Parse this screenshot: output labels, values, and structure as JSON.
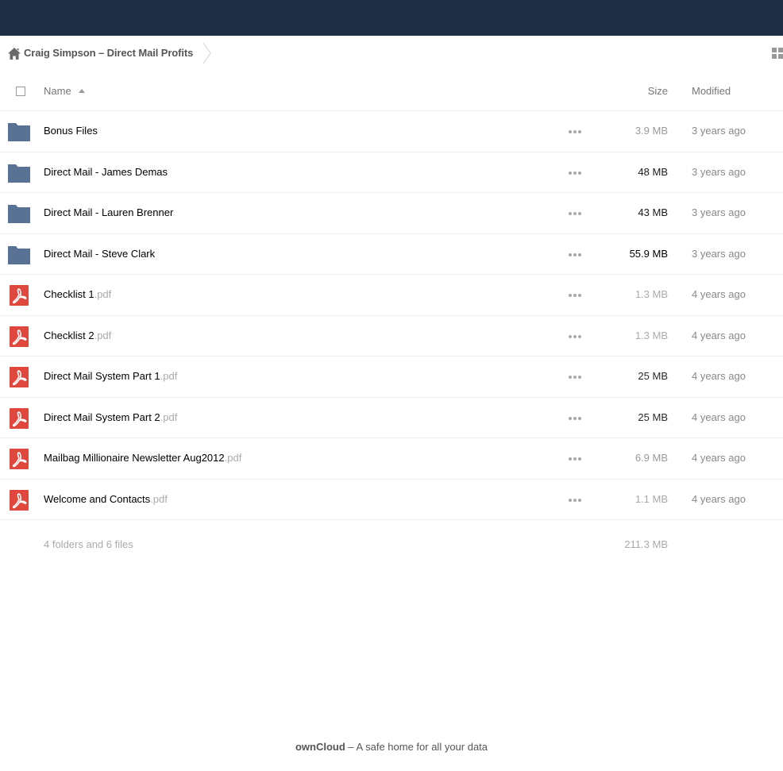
{
  "breadcrumb": {
    "home_icon": "home-icon",
    "title": "Craig Simpson – Direct Mail Profits"
  },
  "header": {
    "name_label": "Name",
    "size_label": "Size",
    "modified_label": "Modified"
  },
  "files": [
    {
      "name": "Bonus Files",
      "ext": "",
      "type": "folder",
      "size": "3.9 MB",
      "size_color": "#9a9a9a",
      "modified": "3 years ago"
    },
    {
      "name": "Direct Mail - James Demas",
      "ext": "",
      "type": "folder",
      "size": "48 MB",
      "size_color": "#1a1a1a",
      "modified": "3 years ago"
    },
    {
      "name": "Direct Mail - Lauren Brenner",
      "ext": "",
      "type": "folder",
      "size": "43 MB",
      "size_color": "#1a1a1a",
      "modified": "3 years ago"
    },
    {
      "name": "Direct Mail - Steve Clark",
      "ext": "",
      "type": "folder",
      "size": "55.9 MB",
      "size_color": "#000000",
      "modified": "3 years ago"
    },
    {
      "name": "Checklist 1",
      "ext": ".pdf",
      "type": "pdf",
      "size": "1.3 MB",
      "size_color": "#aaaaaa",
      "modified": "4 years ago"
    },
    {
      "name": "Checklist 2",
      "ext": ".pdf",
      "type": "pdf",
      "size": "1.3 MB",
      "size_color": "#aaaaaa",
      "modified": "4 years ago"
    },
    {
      "name": "Direct Mail System Part 1",
      "ext": ".pdf",
      "type": "pdf",
      "size": "25 MB",
      "size_color": "#2a2a2a",
      "modified": "4 years ago"
    },
    {
      "name": "Direct Mail System Part 2",
      "ext": ".pdf",
      "type": "pdf",
      "size": "25 MB",
      "size_color": "#2a2a2a",
      "modified": "4 years ago"
    },
    {
      "name": "Mailbag Millionaire Newsletter Aug2012",
      "ext": ".pdf",
      "type": "pdf",
      "size": "6.9 MB",
      "size_color": "#9a9a9a",
      "modified": "4 years ago"
    },
    {
      "name": "Welcome and Contacts",
      "ext": ".pdf",
      "type": "pdf",
      "size": "1.1 MB",
      "size_color": "#aaaaaa",
      "modified": "4 years ago"
    }
  ],
  "summary": {
    "count": "4 folders and 6 files",
    "total_size": "211.3 MB"
  },
  "footer": {
    "brand": "ownCloud",
    "tagline": " – A safe home for all your data"
  },
  "colors": {
    "topbar": "#1d2d44",
    "folder": "#587194",
    "pdf": "#e0483e"
  }
}
